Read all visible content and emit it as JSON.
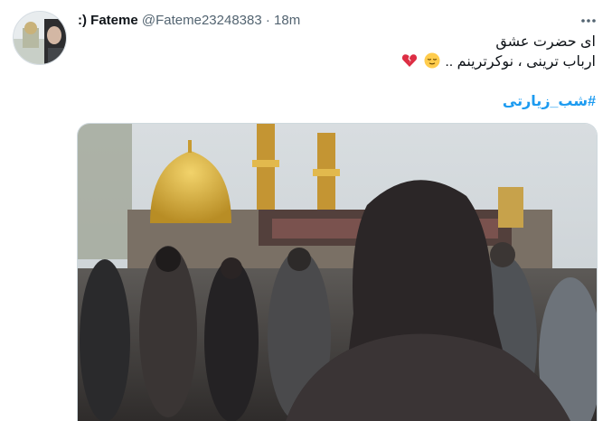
{
  "tweet": {
    "display_name": "Fateme",
    "name_prefix": ":)",
    "handle": "@Fateme23248383",
    "separator": "·",
    "timestamp": "18m",
    "text_line1": "ای حضرت عشق",
    "text_line2": "ارباب ترینی ، نوکرترینم ..",
    "hashtag": "#شب_زیارتی",
    "emojis": [
      "relieved-face-emoji",
      "broken-heart-emoji"
    ],
    "more_icon": "more-horizontal-icon"
  },
  "colors": {
    "link": "#1d9bf0",
    "muted": "#536471",
    "text": "#0f1419",
    "border": "#cfd9de"
  }
}
